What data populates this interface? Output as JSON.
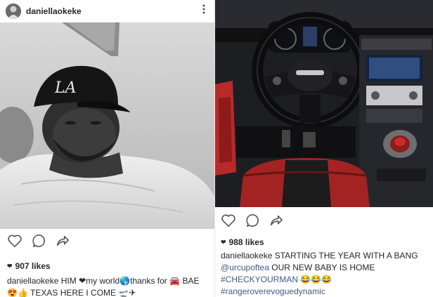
{
  "left_post": {
    "username": "daniellaokeke",
    "likes": "907 likes",
    "caption_user": "daniellaokeke",
    "caption_line1_a": "HIM",
    "caption_line1_b": "my world",
    "caption_line1_c": "thanks for",
    "caption_line1_d": "BAE",
    "caption_line2": "TEXAS HERE I COME",
    "emojis": {
      "heart": "❤",
      "globe": "🌎",
      "car": "🚘",
      "faces": "😍👍",
      "plane": "🛫✈"
    }
  },
  "right_post": {
    "likes": "988 likes",
    "caption_user": "daniellaokeke",
    "caption_line1": "STARTING THE YEAR WITH A BANG",
    "caption_mention": "@urcupoftea",
    "caption_line2_rest": "OUR NEW BABY IS HOME",
    "caption_hashtag1": "#CHECKYOURMAN",
    "caption_hashtag1_emoji": "😂😂😂",
    "caption_hashtag2": "#rangeroverevoguedynamic"
  },
  "icons": [
    "more-vertical-icon",
    "heart-icon",
    "comment-icon",
    "share-icon"
  ]
}
